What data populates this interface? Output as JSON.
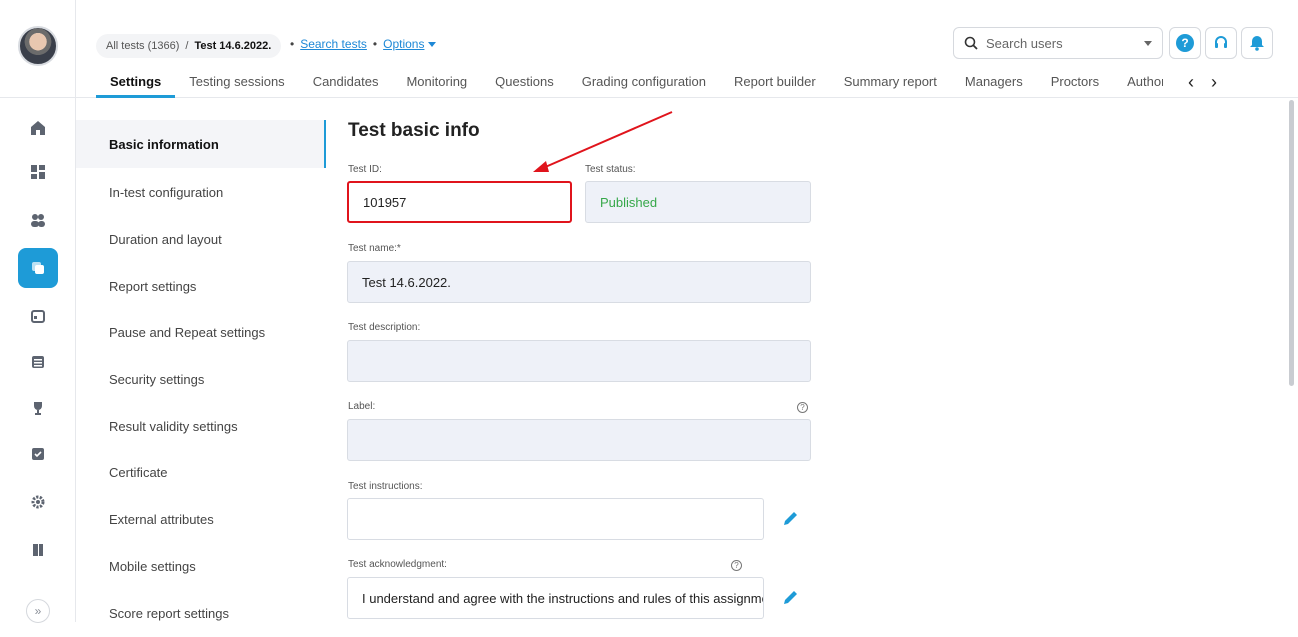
{
  "breadcrumb": {
    "all_tests": "All tests (1366)",
    "separator": "/",
    "current_test": "Test 14.6.2022.",
    "search_tests": "Search tests",
    "options": "Options"
  },
  "header": {
    "search_placeholder": "Search users",
    "help_icon": "question-icon",
    "support_icon": "headset-icon",
    "notify_icon": "bell-icon"
  },
  "tabs": [
    "Settings",
    "Testing sessions",
    "Candidates",
    "Monitoring",
    "Questions",
    "Grading configuration",
    "Report builder",
    "Summary report",
    "Managers",
    "Proctors",
    "Author"
  ],
  "active_tab": "Settings",
  "sections": [
    "Basic information",
    "In-test configuration",
    "Duration and layout",
    "Report settings",
    "Pause and Repeat settings",
    "Security settings",
    "Result validity settings",
    "Certificate",
    "External attributes",
    "Mobile settings",
    "Score report settings"
  ],
  "page": {
    "title": "Test basic info",
    "test_id_label": "Test ID:",
    "test_id_value": "101957",
    "test_status_label": "Test status:",
    "test_status_value": "Published",
    "test_name_label": "Test name:*",
    "test_name_value": "Test 14.6.2022.",
    "test_description_label": "Test description:",
    "test_description_value": "",
    "label_label": "Label:",
    "label_value": "",
    "test_instructions_label": "Test instructions:",
    "test_instructions_value": "",
    "test_ack_label": "Test acknowledgment:",
    "test_ack_value": "I understand and agree with the instructions and rules of this assignment"
  },
  "colors": {
    "accent": "#1e9bd7",
    "highlight": "#e0141c",
    "status_published": "#36a84a"
  }
}
